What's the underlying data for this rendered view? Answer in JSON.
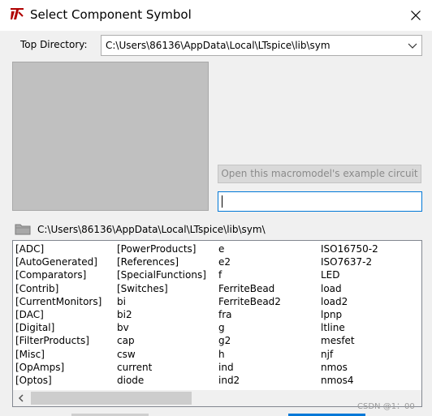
{
  "window": {
    "title": "Select Component Symbol",
    "icons": {
      "app": "ltspice-logo-icon",
      "close": "close-icon"
    }
  },
  "top_directory": {
    "label": "Top Directory:",
    "value": "C:\\Users\\86136\\AppData\\Local\\LTspice\\lib\\sym"
  },
  "example_button": {
    "label": "Open this macromodel's example circuit"
  },
  "search": {
    "value": ""
  },
  "current_path": "C:\\Users\\86136\\AppData\\Local\\LTspice\\lib\\sym\\",
  "list": {
    "columns": [
      [
        "[ADC]",
        "[AutoGenerated]",
        "[Comparators]",
        "[Contrib]",
        "[CurrentMonitors]",
        "[DAC]",
        "[Digital]",
        "[FilterProducts]",
        "[Misc]",
        "[OpAmps]",
        "[Optos]"
      ],
      [
        "[PowerProducts]",
        "[References]",
        "[SpecialFunctions]",
        "[Switches]",
        "bi",
        "bi2",
        "bv",
        "cap",
        "csw",
        "current",
        "diode"
      ],
      [
        "e",
        "e2",
        "f",
        "FerriteBead",
        "FerriteBead2",
        "fra",
        "g",
        "g2",
        "h",
        "ind",
        "ind2"
      ],
      [
        "ISO16750-2",
        "ISO7637-2",
        "LED",
        "load",
        "load2",
        "lpnp",
        "ltline",
        "mesfet",
        "njf",
        "nmos",
        "nmos4"
      ]
    ]
  },
  "watermark": "CSDN @1：00",
  "colors": {
    "accent": "#0078d7",
    "preview_bg": "#c0c0c0",
    "dialog_bg": "#f0f0f0"
  }
}
